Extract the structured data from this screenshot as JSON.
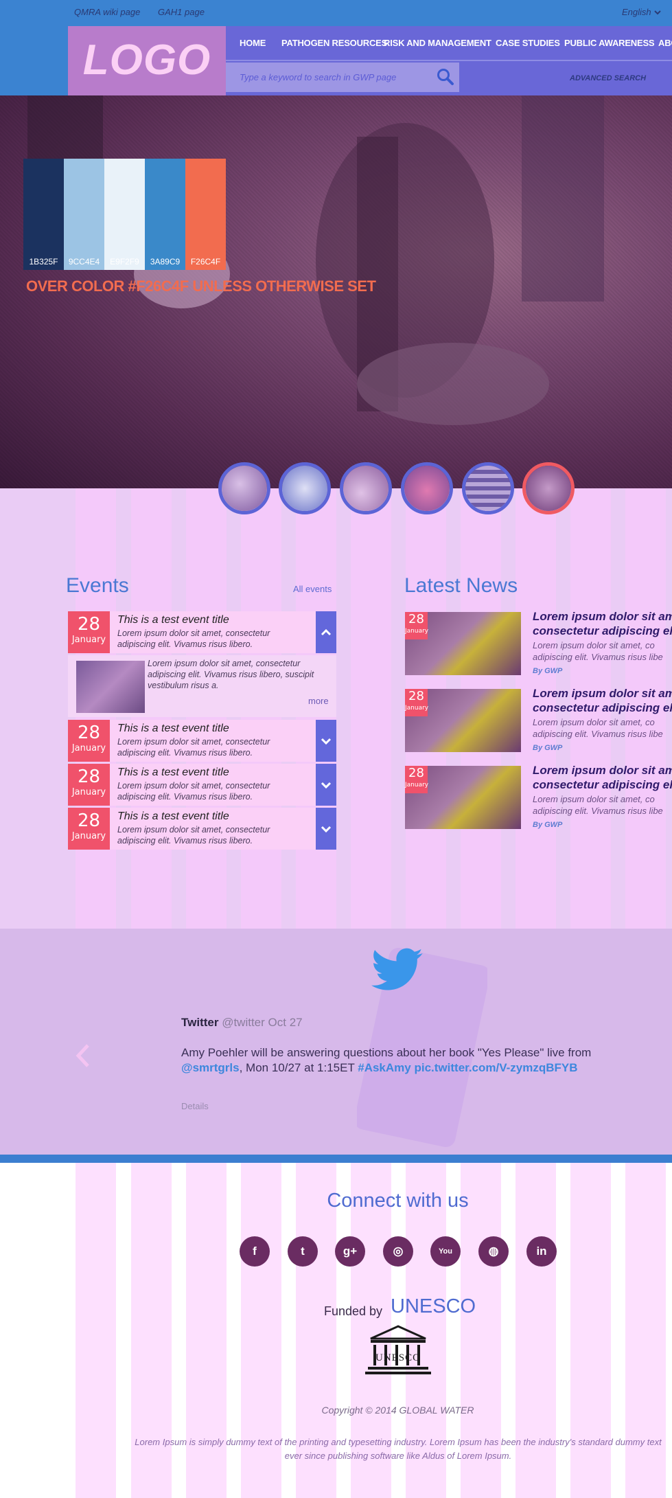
{
  "topbar": {
    "link_qmra": "QMRA wiki page",
    "link_gah": "GAH1 page",
    "language": "English"
  },
  "logo": "LOGO",
  "nav": {
    "items": [
      "HOME",
      "PATHOGEN RESOURCES",
      "RISK AND MANAGEMENT",
      "CASE STUDIES",
      "PUBLIC AWARENESS",
      "ABO"
    ]
  },
  "search": {
    "placeholder": "Type a keyword to search in GWP page",
    "advanced": "ADVANCED SEARCH"
  },
  "palette": [
    {
      "hex": "1B325F",
      "color": "#1b325f"
    },
    {
      "hex": "9CC4E4",
      "color": "#9cc4e4"
    },
    {
      "hex": "E9F2F9",
      "color": "#e9f2f9"
    },
    {
      "hex": "3A89C9",
      "color": "#3a89c9"
    },
    {
      "hex": "F26C4F",
      "color": "#f26c4f"
    }
  ],
  "hover_note": "OVER COLOR #F26C4F UNLESS OTHERWISE SET",
  "events": {
    "title": "Events",
    "all_link": "All events",
    "items": [
      {
        "day": "28",
        "month": "January",
        "title": "This is a test event title",
        "text": "Lorem ipsum dolor sit amet, consectetur adipiscing elit. Vivamus risus libero."
      },
      {
        "day": "28",
        "month": "January",
        "title": "This is a test event title",
        "text": "Lorem ipsum dolor sit amet, consectetur adipiscing elit. Vivamus risus libero."
      },
      {
        "day": "28",
        "month": "January",
        "title": "This is a test event title",
        "text": "Lorem ipsum dolor sit amet, consectetur adipiscing elit. Vivamus risus libero."
      },
      {
        "day": "28",
        "month": "January",
        "title": "This is a test event title",
        "text": "Lorem ipsum dolor sit amet, consectetur adipiscing elit. Vivamus risus libero."
      }
    ],
    "detail_text": "Lorem ipsum dolor sit amet, consectetur adipiscing elit. Vivamus risus libero, suscipit vestibulum risus a.",
    "more": "more"
  },
  "news": {
    "title": "Latest News",
    "items": [
      {
        "day": "28",
        "month": "January",
        "title_line1": "Lorem ipsum dolor sit am",
        "title_line2": "consectetur adipiscing el",
        "text_line1": "Lorem ipsum dolor sit amet, co",
        "text_line2": "adipiscing elit. Vivamus risus libe",
        "by": "By GWP"
      },
      {
        "day": "28",
        "month": "January",
        "title_line1": "Lorem ipsum dolor sit am",
        "title_line2": "consectetur adipiscing el",
        "text_line1": "Lorem ipsum dolor sit amet, co",
        "text_line2": "adipiscing elit. Vivamus risus libe",
        "by": "By GWP"
      },
      {
        "day": "28",
        "month": "January",
        "title_line1": "Lorem ipsum dolor sit am",
        "title_line2": "consectetur adipiscing el",
        "text_line1": "Lorem ipsum dolor sit amet, co",
        "text_line2": "adipiscing elit. Vivamus risus libe",
        "by": "By GWP"
      }
    ]
  },
  "twitter": {
    "user": "Twitter",
    "handle": "@twitter",
    "date": "Oct 27",
    "body_start": "Amy Poehler will be answering questions about her book \"Yes Please\" live from ",
    "mention": "@smrtgrls",
    "body_mid": ", Mon 10/27 at 1:15ET ",
    "hashtag": "#AskAmy",
    "link": "pic.twitter.com/V-zymzqBFYB",
    "details": "Details"
  },
  "footer": {
    "connect": "Connect with us",
    "social": [
      {
        "icon": "facebook-icon",
        "glyph": "f"
      },
      {
        "icon": "twitter-icon",
        "glyph": "t"
      },
      {
        "icon": "google-plus-icon",
        "glyph": "g+"
      },
      {
        "icon": "instagram-icon",
        "glyph": "◎"
      },
      {
        "icon": "youtube-icon",
        "glyph": "You"
      },
      {
        "icon": "dribbble-icon",
        "glyph": "◍"
      },
      {
        "icon": "linkedin-icon",
        "glyph": "in"
      }
    ],
    "funded_by": "Funded by",
    "funder": "UNESCO",
    "unesco_logo_text": "UNESCO",
    "copyright": "Copyright © 2014  GLOBAL WATER",
    "lorem": "Lorem Ipsum is simply dummy text of the printing and typesetting industry. Lorem Ipsum has been the industry's standard dummy text ever since publishing software like Aldus of Lorem Ipsum."
  },
  "colors": {
    "accent": "#f26c4f",
    "date_badge": "#f0526b",
    "nav_band": "#6967d7",
    "header_blue": "#3b83d1"
  }
}
